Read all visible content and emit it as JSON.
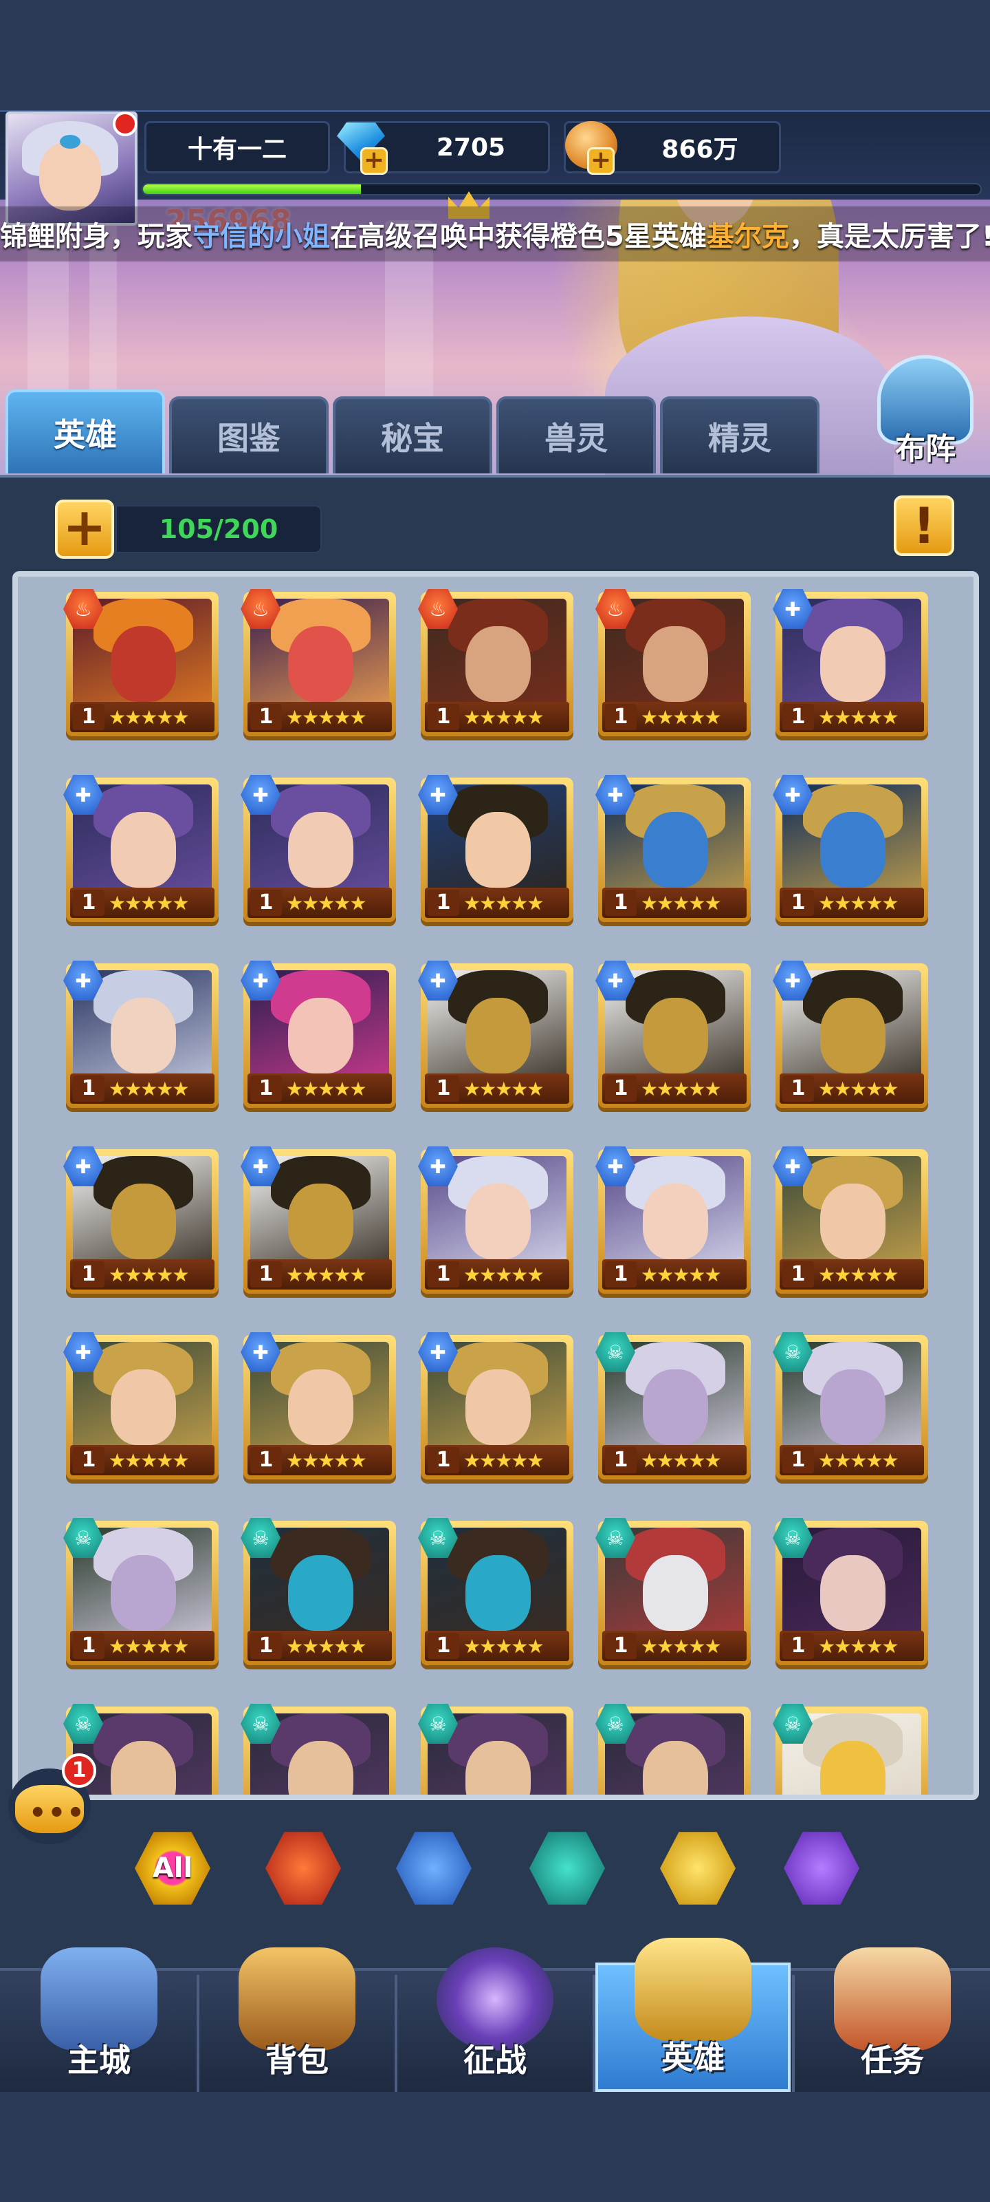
{
  "player": {
    "name": "十有一二",
    "gems": "2705",
    "gold": "866万",
    "xp_fraction": 0.26,
    "power_partial": "256968"
  },
  "marquee": {
    "part1": "锦鲤附身，玩家",
    "player": "守信的小姐",
    "part2": "在高级召唤中获得橙色5星英雄",
    "hero": "基尔克",
    "part3": "，真是太厉害了!"
  },
  "tabs": [
    {
      "label": "英雄",
      "active": true
    },
    {
      "label": "图鉴",
      "active": false
    },
    {
      "label": "秘宝",
      "active": false
    },
    {
      "label": "兽灵",
      "active": false
    },
    {
      "label": "精灵",
      "active": false
    }
  ],
  "formation_label": "布阵",
  "hero_count": "105/200",
  "info_icon": "exclamation-icon",
  "heroes": [
    {
      "faction": "fire",
      "level": "1",
      "stars": 5,
      "portrait": "demon-dragon",
      "colors": [
        "#5b1b2a",
        "#c0392b",
        "#e67e22"
      ]
    },
    {
      "faction": "fire",
      "level": "1",
      "stars": 5,
      "portrait": "horned-demon",
      "colors": [
        "#3a1f4f",
        "#e0524a",
        "#f0a050"
      ]
    },
    {
      "faction": "fire",
      "level": "1",
      "stars": 5,
      "portrait": "scarred-warrior",
      "colors": [
        "#3e2a20",
        "#d8a47f",
        "#7a2d1b"
      ]
    },
    {
      "faction": "fire",
      "level": "1",
      "stars": 5,
      "portrait": "scarred-warrior",
      "colors": [
        "#3e2a20",
        "#d8a47f",
        "#7a2d1b"
      ]
    },
    {
      "faction": "water",
      "level": "1",
      "stars": 5,
      "portrait": "goggle-girl",
      "colors": [
        "#2b2d5a",
        "#f2cbb5",
        "#6a4ea0"
      ]
    },
    {
      "faction": "water",
      "level": "1",
      "stars": 5,
      "portrait": "goggle-girl",
      "colors": [
        "#2b2d5a",
        "#f2cbb5",
        "#6a4ea0"
      ]
    },
    {
      "faction": "water",
      "level": "1",
      "stars": 5,
      "portrait": "goggle-girl",
      "colors": [
        "#2b2d5a",
        "#f2cbb5",
        "#6a4ea0"
      ]
    },
    {
      "faction": "water",
      "level": "1",
      "stars": 5,
      "portrait": "dark-haired-man",
      "colors": [
        "#1f3f7a",
        "#f1c9a7",
        "#2d2418"
      ]
    },
    {
      "faction": "water",
      "level": "1",
      "stars": 5,
      "portrait": "armored-knight",
      "colors": [
        "#0f2c5a",
        "#3a7ed0",
        "#c7a24a"
      ]
    },
    {
      "faction": "water",
      "level": "1",
      "stars": 5,
      "portrait": "armored-knight",
      "colors": [
        "#0f2c5a",
        "#3a7ed0",
        "#c7a24a"
      ]
    },
    {
      "faction": "water",
      "level": "1",
      "stars": 5,
      "portrait": "silver-hair-man",
      "colors": [
        "#2a3560",
        "#f0d2c0",
        "#c7cde2"
      ]
    },
    {
      "faction": "water",
      "level": "1",
      "stars": 5,
      "portrait": "pink-sorceress",
      "colors": [
        "#2a1f4f",
        "#f2c3b6",
        "#d13b8f"
      ]
    },
    {
      "faction": "water",
      "level": "1",
      "stars": 5,
      "portrait": "gold-helm",
      "colors": [
        "#f4f4f4",
        "#c49a3c",
        "#2d2418"
      ]
    },
    {
      "faction": "water",
      "level": "1",
      "stars": 5,
      "portrait": "gold-helm",
      "colors": [
        "#f4f4f4",
        "#c49a3c",
        "#2d2418"
      ]
    },
    {
      "faction": "water",
      "level": "1",
      "stars": 5,
      "portrait": "gold-helm",
      "colors": [
        "#f4f4f4",
        "#c49a3c",
        "#2d2418"
      ]
    },
    {
      "faction": "water",
      "level": "1",
      "stars": 5,
      "portrait": "gold-helm",
      "colors": [
        "#f4f4f4",
        "#c49a3c",
        "#2d2418"
      ]
    },
    {
      "faction": "water",
      "level": "1",
      "stars": 5,
      "portrait": "gold-helm",
      "colors": [
        "#f4f4f4",
        "#c49a3c",
        "#2d2418"
      ]
    },
    {
      "faction": "water",
      "level": "1",
      "stars": 5,
      "portrait": "white-hood-mage",
      "colors": [
        "#5a4a8a",
        "#f2d0bd",
        "#d9dcef"
      ]
    },
    {
      "faction": "water",
      "level": "1",
      "stars": 5,
      "portrait": "white-hood-mage",
      "colors": [
        "#5a4a8a",
        "#f2d0bd",
        "#d9dcef"
      ]
    },
    {
      "faction": "water",
      "level": "1",
      "stars": 5,
      "portrait": "elf-warrior",
      "colors": [
        "#3a4a3a",
        "#f0c8a8",
        "#c9a24a"
      ]
    },
    {
      "faction": "water",
      "level": "1",
      "stars": 5,
      "portrait": "elf-warrior",
      "colors": [
        "#3a4a3a",
        "#f0c8a8",
        "#c9a24a"
      ]
    },
    {
      "faction": "water",
      "level": "1",
      "stars": 5,
      "portrait": "elf-warrior",
      "colors": [
        "#3a4a3a",
        "#f0c8a8",
        "#c9a24a"
      ]
    },
    {
      "faction": "water",
      "level": "1",
      "stars": 5,
      "portrait": "elf-warrior",
      "colors": [
        "#3a4a3a",
        "#f0c8a8",
        "#c9a24a"
      ]
    },
    {
      "faction": "dark",
      "level": "1",
      "stars": 5,
      "portrait": "pale-sorceress",
      "colors": [
        "#2a3a2a",
        "#b9a6d0",
        "#d6d0e6"
      ]
    },
    {
      "faction": "dark",
      "level": "1",
      "stars": 5,
      "portrait": "pale-sorceress",
      "colors": [
        "#2a3a2a",
        "#b9a6d0",
        "#d6d0e6"
      ]
    },
    {
      "faction": "dark",
      "level": "1",
      "stars": 5,
      "portrait": "pale-sorceress",
      "colors": [
        "#2a3a2a",
        "#b9a6d0",
        "#d6d0e6"
      ]
    },
    {
      "faction": "dark",
      "level": "1",
      "stars": 5,
      "portrait": "masked-beast",
      "colors": [
        "#1f2f3f",
        "#2aa8c8",
        "#3a2a1f"
      ]
    },
    {
      "faction": "dark",
      "level": "1",
      "stars": 5,
      "portrait": "masked-beast",
      "colors": [
        "#1f2f3f",
        "#2aa8c8",
        "#3a2a1f"
      ]
    },
    {
      "faction": "dark",
      "level": "1",
      "stars": 5,
      "portrait": "white-wolf",
      "colors": [
        "#3a3a3a",
        "#e6e6ea",
        "#b23a3a"
      ]
    },
    {
      "faction": "dark",
      "level": "1",
      "stars": 5,
      "portrait": "dark-queen",
      "colors": [
        "#2a1a3a",
        "#e8c8c0",
        "#4a2a5a"
      ]
    },
    {
      "faction": "dark",
      "level": "1",
      "stars": 5,
      "portrait": "horned-witch",
      "colors": [
        "#2a2a3a",
        "#e6c09a",
        "#5a3a6a"
      ]
    },
    {
      "faction": "dark",
      "level": "1",
      "stars": 5,
      "portrait": "horned-witch",
      "colors": [
        "#2a2a3a",
        "#e6c09a",
        "#5a3a6a"
      ]
    },
    {
      "faction": "dark",
      "level": "1",
      "stars": 5,
      "portrait": "horned-witch",
      "colors": [
        "#2a2a3a",
        "#e6c09a",
        "#5a3a6a"
      ]
    },
    {
      "faction": "dark",
      "level": "1",
      "stars": 5,
      "portrait": "horned-witch",
      "colors": [
        "#2a2a3a",
        "#e6c09a",
        "#5a3a6a"
      ]
    },
    {
      "faction": "dark",
      "level": "1",
      "stars": 5,
      "portrait": "winged-angel",
      "colors": [
        "#f4f0e8",
        "#f0c040",
        "#d9d0c0"
      ]
    }
  ],
  "chat_badge": "1",
  "filters": [
    {
      "label": "All",
      "icon": "all-filter-icon"
    },
    {
      "label": "",
      "icon": "fire-faction-icon"
    },
    {
      "label": "",
      "icon": "water-faction-icon"
    },
    {
      "label": "",
      "icon": "skull-faction-icon"
    },
    {
      "label": "",
      "icon": "light-faction-icon"
    },
    {
      "label": "",
      "icon": "void-faction-icon"
    }
  ],
  "nav": [
    {
      "label": "主城",
      "icon": "castle-icon",
      "active": false,
      "color": "#5f8fd6"
    },
    {
      "label": "背包",
      "icon": "treasure-chest-icon",
      "active": false,
      "color": "#d09a3a"
    },
    {
      "label": "征战",
      "icon": "dragon-portal-icon",
      "active": false,
      "color": "#7a5ac8"
    },
    {
      "label": "英雄",
      "icon": "golden-helmet-icon",
      "active": true,
      "color": "#e8c25a"
    },
    {
      "label": "任务",
      "icon": "scroll-icon",
      "active": false,
      "color": "#d26a3a"
    }
  ]
}
